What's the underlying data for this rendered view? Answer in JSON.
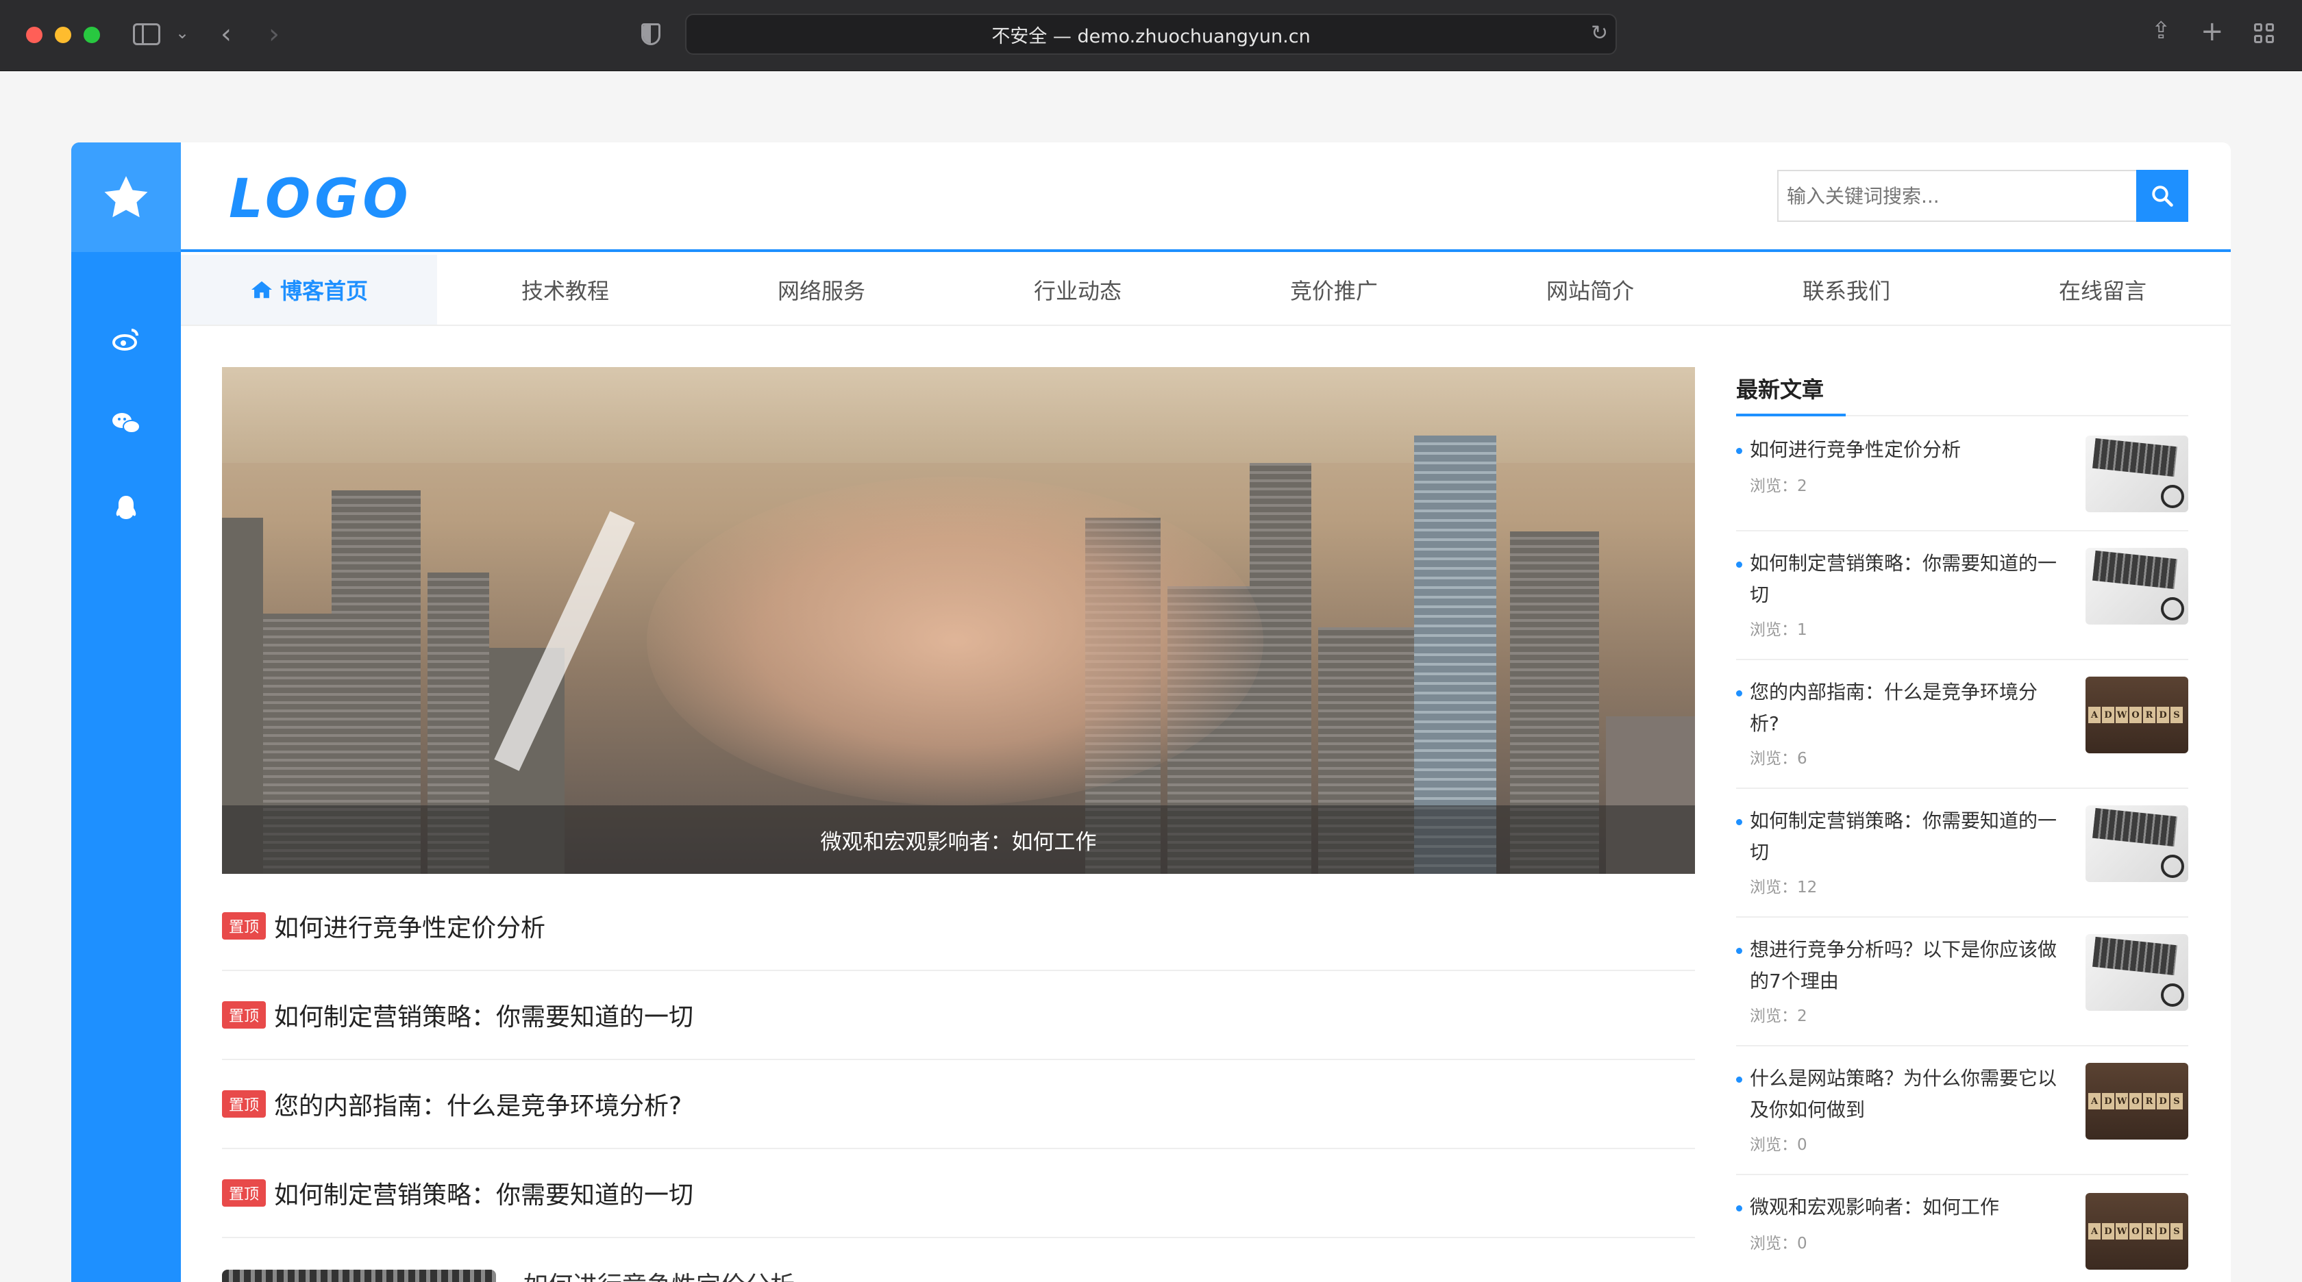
{
  "browser": {
    "url_text": "不安全 — demo.zhuochuangyun.cn"
  },
  "site": {
    "logo_text": "LOGO",
    "search_placeholder": "输入关键词搜索...",
    "accent_color": "#1e90ff"
  },
  "nav": {
    "items": [
      {
        "label": "博客首页",
        "active": true
      },
      {
        "label": "技术教程"
      },
      {
        "label": "网络服务"
      },
      {
        "label": "行业动态"
      },
      {
        "label": "竞价推广"
      },
      {
        "label": "网站简介"
      },
      {
        "label": "联系我们"
      },
      {
        "label": "在线留言"
      }
    ]
  },
  "left_social": [
    "star-icon",
    "weibo-icon",
    "wechat-icon",
    "qq-icon"
  ],
  "banner": {
    "caption": "微观和宏观影响者：如何工作"
  },
  "articles": {
    "tag_label": "置顶",
    "items": [
      {
        "title": "如何进行竞争性定价分析"
      },
      {
        "title": "如何制定营销策略：你需要知道的一切"
      },
      {
        "title": "您的内部指南：什么是竞争环境分析?"
      },
      {
        "title": "如何制定营销策略：你需要知道的一切"
      }
    ],
    "partial_title": "如何进行竞争性定价分析"
  },
  "sidebar": {
    "title": "最新文章",
    "views_label": "浏览",
    "items": [
      {
        "title": "如何进行竞争性定价分析",
        "views": "浏览：2",
        "thumb": "keyboard"
      },
      {
        "title": "如何制定营销策略：你需要知道的一切",
        "views": "浏览：1",
        "thumb": "keyboard"
      },
      {
        "title": "您的内部指南：什么是竞争环境分析?",
        "views": "浏览：6",
        "thumb": "adwords"
      },
      {
        "title": "如何制定营销策略：你需要知道的一切",
        "views": "浏览：12",
        "thumb": "keyboard"
      },
      {
        "title": "想进行竞争分析吗？以下是你应该做的7个理由",
        "views": "浏览：2",
        "thumb": "keyboard"
      },
      {
        "title": "什么是网站策略？为什么你需要它以及你如何做到",
        "views": "浏览：0",
        "thumb": "adwords"
      },
      {
        "title": "微观和宏观影响者：如何工作",
        "views": "浏览：0",
        "thumb": "adwords"
      }
    ],
    "adwords_letters": [
      "A",
      "D",
      "W",
      "O",
      "R",
      "D",
      "S"
    ]
  }
}
